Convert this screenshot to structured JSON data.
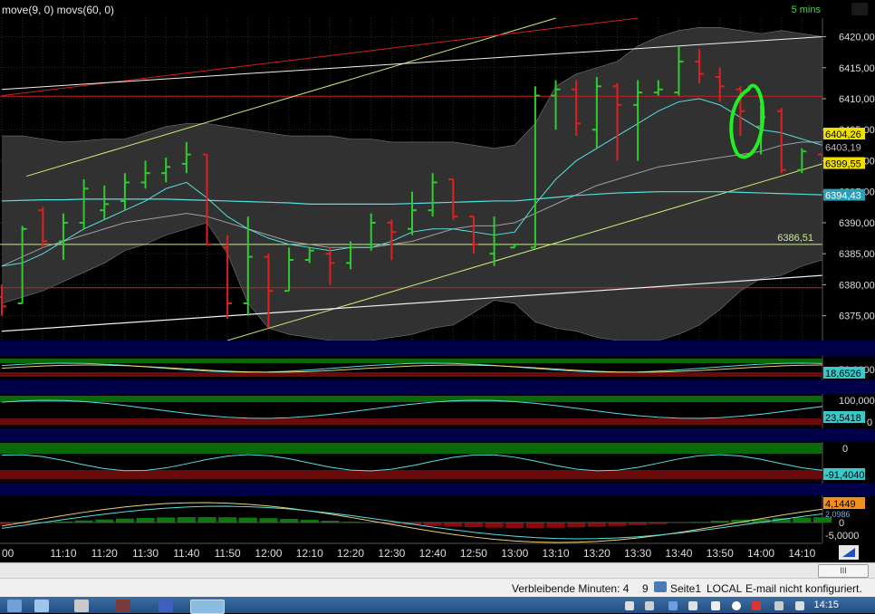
{
  "window": {
    "title": "move(9, 0) movs(60, 0)",
    "timeframe": "5 mins"
  },
  "colors": {
    "up_bar": "#2ecc2e",
    "down_bar": "#e02020",
    "band_fill": "#3a3a3a",
    "ma_cyan": "#55e0e0",
    "ma_grey": "#a0a0a0",
    "trend_yellow": "#c8f078",
    "trend_red": "#d02020",
    "trend_white": "#f0f0f0",
    "annotation": "#22ee22"
  },
  "chart_data": [
    {
      "type": "ohlc",
      "panel": "price",
      "x": [
        "10:55",
        "11:00",
        "11:05",
        "11:10",
        "11:15",
        "11:20",
        "11:25",
        "11:30",
        "11:35",
        "11:40",
        "11:45",
        "11:50",
        "11:55",
        "12:00",
        "12:05",
        "12:10",
        "12:15",
        "12:20",
        "12:25",
        "12:30",
        "12:35",
        "12:40",
        "12:45",
        "12:50",
        "12:55",
        "13:00",
        "13:05",
        "13:10",
        "13:15",
        "13:20",
        "13:25",
        "13:30",
        "13:35",
        "13:40",
        "13:45",
        "13:50",
        "13:55",
        "14:00",
        "14:05",
        "14:10",
        "14:15"
      ],
      "bars": [
        {
          "o": 6378.0,
          "h": 6380.0,
          "l": 6375.0,
          "c": 6376.5
        },
        {
          "o": 6377.0,
          "h": 6389.5,
          "l": 6377.0,
          "c": 6389.0
        },
        {
          "o": 6392.0,
          "h": 6392.5,
          "l": 6386.0,
          "c": 6387.0
        },
        {
          "o": 6387.0,
          "h": 6391.5,
          "l": 6384.0,
          "c": 6390.0
        },
        {
          "o": 6390.0,
          "h": 6397.0,
          "l": 6389.0,
          "c": 6395.5
        },
        {
          "o": 6392.0,
          "h": 6396.0,
          "l": 6390.5,
          "c": 6393.0
        },
        {
          "o": 6393.5,
          "h": 6398.0,
          "l": 6392.0,
          "c": 6396.5
        },
        {
          "o": 6396.5,
          "h": 6400.0,
          "l": 6395.5,
          "c": 6398.0
        },
        {
          "o": 6398.0,
          "h": 6400.5,
          "l": 6396.5,
          "c": 6399.0
        },
        {
          "o": 6399.5,
          "h": 6403.0,
          "l": 6398.0,
          "c": 6401.0
        },
        {
          "o": 6401.0,
          "h": 6401.0,
          "l": 6386.5,
          "c": 6386.5
        },
        {
          "o": 6386.0,
          "h": 6388.0,
          "l": 6374.5,
          "c": 6377.0
        },
        {
          "o": 6377.0,
          "h": 6391.0,
          "l": 6375.0,
          "c": 6384.5
        },
        {
          "o": 6384.5,
          "h": 6385.0,
          "l": 6373.0,
          "c": 6379.0
        },
        {
          "o": 6379.0,
          "h": 6386.0,
          "l": 6379.0,
          "c": 6384.0
        },
        {
          "o": 6384.0,
          "h": 6386.0,
          "l": 6383.5,
          "c": 6385.5
        },
        {
          "o": 6385.0,
          "h": 6386.0,
          "l": 6380.0,
          "c": 6383.5
        },
        {
          "o": 6383.5,
          "h": 6387.0,
          "l": 6382.5,
          "c": 6386.0
        },
        {
          "o": 6386.5,
          "h": 6391.5,
          "l": 6385.5,
          "c": 6390.0
        },
        {
          "o": 6390.0,
          "h": 6390.5,
          "l": 6384.0,
          "c": 6388.5
        },
        {
          "o": 6389.0,
          "h": 6395.0,
          "l": 6388.0,
          "c": 6392.0
        },
        {
          "o": 6392.0,
          "h": 6398.0,
          "l": 6391.0,
          "c": 6396.5
        },
        {
          "o": 6397.0,
          "h": 6397.0,
          "l": 6390.5,
          "c": 6391.0
        },
        {
          "o": 6391.0,
          "h": 6391.0,
          "l": 6385.0,
          "c": 6386.5
        },
        {
          "o": 6385.0,
          "h": 6391.0,
          "l": 6383.0,
          "c": 6386.5
        },
        {
          "o": 6386.0,
          "h": 6386.5,
          "l": 6386.0,
          "c": 6386.5
        },
        {
          "o": 6386.0,
          "h": 6412.0,
          "l": 6386.0,
          "c": 6410.5
        },
        {
          "o": 6410.5,
          "h": 6413.0,
          "l": 6405.0,
          "c": 6411.5
        },
        {
          "o": 6411.5,
          "h": 6413.0,
          "l": 6404.0,
          "c": 6406.0
        },
        {
          "o": 6405.0,
          "h": 6413.5,
          "l": 6402.0,
          "c": 6412.0
        },
        {
          "o": 6412.0,
          "h": 6412.5,
          "l": 6400.0,
          "c": 6409.0
        },
        {
          "o": 6409.0,
          "h": 6413.0,
          "l": 6400.0,
          "c": 6411.0
        },
        {
          "o": 6411.0,
          "h": 6413.0,
          "l": 6410.5,
          "c": 6411.5
        },
        {
          "o": 6411.0,
          "h": 6418.5,
          "l": 6410.5,
          "c": 6416.0
        },
        {
          "o": 6416.0,
          "h": 6418.0,
          "l": 6412.5,
          "c": 6414.0
        },
        {
          "o": 6413.5,
          "h": 6415.0,
          "l": 6409.5,
          "c": 6412.0
        },
        {
          "o": 6411.5,
          "h": 6412.0,
          "l": 6404.0,
          "c": 6408.0
        },
        {
          "o": 6405.5,
          "h": 6409.0,
          "l": 6401.0,
          "c": 6407.0
        },
        {
          "o": 6408.0,
          "h": 6408.5,
          "l": 6398.0,
          "c": 6398.5
        },
        {
          "o": 6398.5,
          "h": 6402.0,
          "l": 6398.0,
          "c": 6401.5
        },
        {
          "o": 6401.0,
          "h": 6401.0,
          "l": 6399.5,
          "c": 6399.6
        }
      ],
      "bollinger_upper": [
        6404.0,
        6404.0,
        6403.5,
        6403.0,
        6403.2,
        6403.5,
        6403.5,
        6404.5,
        6405.5,
        6406.0,
        6406.0,
        6405.5,
        6405.0,
        6404.5,
        6404.0,
        6404.0,
        6404.0,
        6403.5,
        6403.5,
        6403.0,
        6403.0,
        6403.0,
        6403.0,
        6402.5,
        6402.0,
        6402.5,
        6406.0,
        6412.0,
        6414.0,
        6415.0,
        6416.0,
        6418.5,
        6420.0,
        6421.0,
        6421.5,
        6421.5,
        6421.0,
        6420.5,
        6421.0,
        6420.5,
        6420.0
      ],
      "bollinger_lower": [
        6377.0,
        6378.0,
        6379.0,
        6380.5,
        6382.0,
        6383.5,
        6385.5,
        6386.5,
        6388.0,
        6389.0,
        6390.0,
        6385.0,
        6377.0,
        6373.0,
        6372.0,
        6371.5,
        6371.0,
        6371.0,
        6371.0,
        6371.5,
        6372.0,
        6373.0,
        6373.5,
        6375.5,
        6377.5,
        6377.0,
        6374.0,
        6373.0,
        6372.5,
        6371.5,
        6371.0,
        6371.0,
        6371.0,
        6372.0,
        6373.5,
        6376.0,
        6379.0,
        6381.0,
        6381.5,
        6383.0,
        6384.0
      ],
      "ma9": [
        6383.0,
        6383.5,
        6385.0,
        6387.0,
        6389.0,
        6390.5,
        6392.0,
        6393.5,
        6395.5,
        6396.5,
        6394.0,
        6391.0,
        6389.0,
        6387.5,
        6386.5,
        6386.0,
        6385.5,
        6386.0,
        6386.0,
        6387.0,
        6388.5,
        6389.0,
        6389.0,
        6388.5,
        6388.0,
        6388.5,
        6393.0,
        6397.0,
        6400.0,
        6402.0,
        6404.0,
        6406.0,
        6408.0,
        6409.5,
        6410.0,
        6409.0,
        6407.0,
        6405.0,
        6404.5,
        6403.5,
        6402.5
      ],
      "ma60": [
        6393.5,
        6393.6,
        6393.7,
        6393.7,
        6393.8,
        6393.8,
        6393.8,
        6393.8,
        6393.8,
        6393.7,
        6393.6,
        6393.5,
        6393.4,
        6393.3,
        6393.2,
        6393.0,
        6393.0,
        6393.0,
        6393.0,
        6393.0,
        6393.1,
        6393.2,
        6393.3,
        6393.4,
        6393.5,
        6393.5,
        6393.8,
        6394.1,
        6394.4,
        6394.6,
        6394.8,
        6394.9,
        6395.0,
        6395.0,
        6395.0,
        6395.0,
        6394.9,
        6394.8,
        6394.7,
        6394.6,
        6394.5
      ],
      "ma_grey": [
        6383.0,
        6384.5,
        6386.0,
        6387.0,
        6388.0,
        6389.0,
        6390.0,
        6390.5,
        6391.0,
        6391.5,
        6391.0,
        6390.0,
        6389.0,
        6388.0,
        6387.0,
        6386.5,
        6386.0,
        6386.0,
        6386.0,
        6386.5,
        6387.0,
        6388.0,
        6389.0,
        6389.5,
        6389.5,
        6390.0,
        6391.5,
        6393.0,
        6394.5,
        6396.0,
        6397.0,
        6398.0,
        6399.0,
        6399.5,
        6400.0,
        6400.5,
        6401.0,
        6401.5,
        6402.5,
        6403.0,
        6403.0
      ],
      "y_ticks": [
        "6375,00",
        "6380,00",
        "6385,00",
        "6390,00",
        "6395,00",
        "6400,00",
        "6405,00",
        "6410,00",
        "6415,00",
        "6420,00"
      ],
      "ylim": [
        6371.0,
        6423.0
      ],
      "horizontal_lines": [
        {
          "value": 6386.51,
          "label": "6386,51",
          "color": "#c8f078"
        },
        {
          "value": 6379.5,
          "label": "",
          "color": "#d02020"
        },
        {
          "value": 6410.4,
          "label": "",
          "color": "#d02020"
        }
      ],
      "price_labels": {
        "upper": "6404,26",
        "upper_sub": "6403,19",
        "last": "6399,55",
        "ma60": "6394,43"
      },
      "x_tick_labels": [
        "00",
        "11:10",
        "11:20",
        "11:30",
        "11:40",
        "11:50",
        "12:00",
        "12:10",
        "12:20",
        "12:30",
        "12:40",
        "12:50",
        "13:00",
        "13:10",
        "13:20",
        "13:30",
        "13:40",
        "13:50",
        "14:00",
        "14:10"
      ]
    },
    {
      "type": "line",
      "panel": "oscillator-1",
      "y_top_label": "50,0000",
      "value_label": "18,6526",
      "zero_label": "0"
    },
    {
      "type": "line",
      "panel": "oscillator-2",
      "y_top_label": "100,0000",
      "value_label": "23,5418",
      "zero_label": "0"
    },
    {
      "type": "line",
      "panel": "oscillator-3",
      "y_top_label": "0",
      "value_label": "-91,4040",
      "zero_label": "0"
    },
    {
      "type": "bar",
      "panel": "oscillator-4",
      "value_label": "4,1449",
      "value_label_sub": "2,0986",
      "zero_label": "0",
      "bottom_label": "-5,0000"
    }
  ],
  "statusbar": {
    "minutes": "Verbleibende Minuten: 4",
    "count": "9",
    "page": "Seite1",
    "mode": "LOCAL",
    "email": "E-mail nicht konfiguriert."
  },
  "taskbar": {
    "clock": "14:15"
  },
  "scroll": {
    "thumb_label": "III"
  }
}
